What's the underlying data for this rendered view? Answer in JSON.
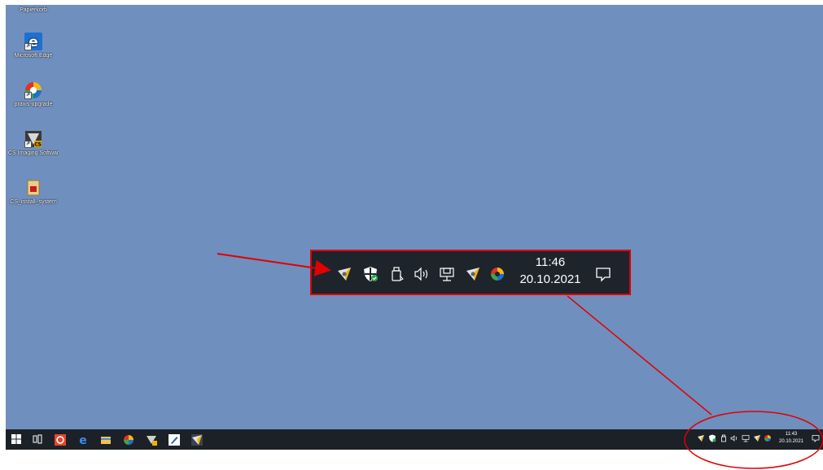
{
  "desktop": {
    "icons": [
      {
        "label": "Papierkorb",
        "icon": "recycle-bin-icon"
      },
      {
        "label": "Microsoft Edge",
        "icon": "edge-icon"
      },
      {
        "label": "praxis-upgrade",
        "icon": "praxis-upgrade-icon"
      },
      {
        "label": "CS Imaging Software",
        "icon": "cs-imaging-icon"
      },
      {
        "label": "CS_install_system",
        "icon": "installer-icon"
      }
    ],
    "background_color": "#6f8fbe"
  },
  "zoomed_tray": {
    "time": "11:46",
    "date": "20.10.2021",
    "icons": [
      "cs-imaging-tray-icon",
      "defender-icon",
      "usb-icon",
      "volume-icon",
      "network-icon",
      "cs-imaging-tray-icon-2",
      "praxis-tray-icon",
      "notification-icon"
    ]
  },
  "taskbar": {
    "time": "11:43",
    "date": "20.10.2021",
    "apps": [
      "windows-start-icon",
      "task-view-icon",
      "app-red-icon",
      "edge-icon",
      "file-explorer-icon",
      "praxis-icon",
      "cs-imaging-icon",
      "pen-app-icon",
      "cs-tray-app-icon"
    ]
  },
  "annotation_colors": {
    "highlight": "#e00000"
  }
}
